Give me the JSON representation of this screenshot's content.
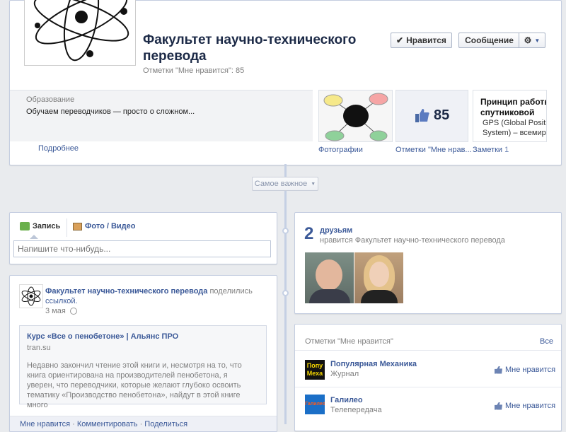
{
  "page": {
    "title": "Факультет научно-технического перевода",
    "likes_line": "Отметки \"Мне нравится\": 85",
    "like_button": "Нравится",
    "message_button": "Сообщение"
  },
  "about": {
    "label": "Образование",
    "text": "Обучаем переводчиков — просто о сложном...",
    "more": "Подробнее"
  },
  "apps": {
    "photos": "Фотографии",
    "likes_count": "85",
    "likes_label": "Отметки \"Мне нрав...",
    "notes_label": "Заметки",
    "notes_count": "1",
    "note_title_1": "Принцип работы",
    "note_title_2": "спутниковой",
    "note_snippet_1": "GPS (Global Positioni",
    "note_snippet_2": "System) – всемирна"
  },
  "filter": {
    "label": "Самое важное"
  },
  "composer": {
    "tab_post": "Запись",
    "tab_photo": "Фото / Видео",
    "placeholder": "Напишите что-нибудь..."
  },
  "post": {
    "author": "Факультет научно-технического перевода",
    "shared": "поделились",
    "link_word": "ссылкой.",
    "date": "3 мая",
    "link_title": "Курс «Все о пенобетоне» | Альянс ПРО",
    "link_domain": "tran.su",
    "link_desc": "Недавно закончил чтение этой книги и, несмотря на то, что книга ориентирована на производителей пенобетона, я уверен, что переводчики, которые желают глубоко освоить тематику «Производство пенобетона», найдут в этой книге много",
    "action_like": "Мне нравится",
    "action_comment": "Комментировать",
    "action_share": "Поделиться",
    "sep": " · "
  },
  "friends": {
    "count": "2",
    "word": "друзьям",
    "sub": "нравится Факультет научно-технического перевода"
  },
  "likes": {
    "header": "Отметки \"Мне нравится\"",
    "all": "Все",
    "items": [
      {
        "name": "Популярная Механика",
        "category": "Журнал",
        "thumb": "Попу\nМеха",
        "button": "Мне нравится"
      },
      {
        "name": "Галилео",
        "category": "Телепередача",
        "thumb": "Галилео",
        "button": "Мне нравится"
      }
    ]
  }
}
